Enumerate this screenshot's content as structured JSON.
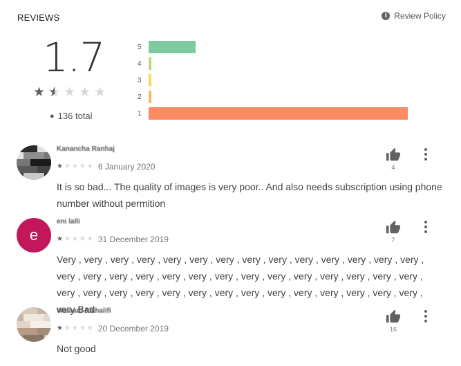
{
  "header": {
    "title": "REVIEWS",
    "policy_label": "Review Policy",
    "policy_icon": "info-icon"
  },
  "summary": {
    "rating": "1.7",
    "rating_value": 1.7,
    "total_label": "136 total",
    "user_icon": "person-icon"
  },
  "histogram": [
    {
      "label": "5",
      "fraction": 0.18,
      "color": "#7dcb9f"
    },
    {
      "label": "4",
      "fraction": 0.01,
      "color": "#b5dd7e"
    },
    {
      "label": "3",
      "fraction": 0.01,
      "color": "#f5d962"
    },
    {
      "label": "2",
      "fraction": 0.01,
      "color": "#f6b862"
    },
    {
      "label": "1",
      "fraction": 1.0,
      "color": "#fc8a63"
    }
  ],
  "reviews": [
    {
      "name": "Kanancha Ranhaj",
      "avatar_type": "photo",
      "rating": 1,
      "date": "6 January 2020",
      "text": "It is so bad... The quality of images is very poor.. And also needs subscription using phone number without permition",
      "likes": "4"
    },
    {
      "name": "eni lalli",
      "avatar_type": "letter",
      "avatar_letter": "e",
      "rating": 1,
      "date": "31 December 2019",
      "text": "Very , very , very , very , very , very , very , very , very , very , very , very , very , very , very , very , very , very , very , very , very , very , very , very , very , very , very , very , very , very , very , very , very , very , very , very , very , very , very , very , very , very , very Bad",
      "likes": "7"
    },
    {
      "name": "Walaadi Alkhalifi",
      "avatar_type": "photo",
      "rating": 1,
      "date": "20 December 2019",
      "text": "Not good",
      "likes": "16"
    }
  ],
  "colors": {
    "avatar_letter_bg": "#c2185b",
    "star_active": "#616161",
    "star_inactive": "#d8d8d8"
  }
}
